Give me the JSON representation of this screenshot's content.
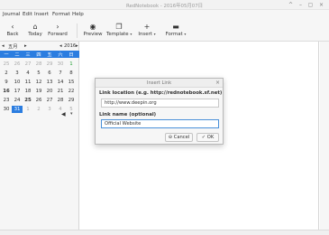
{
  "window": {
    "title": "RedNotebook - 2016年05月07日",
    "controls": [
      "^",
      "–",
      "▢",
      "×"
    ]
  },
  "menu": [
    "Journal",
    "Edit",
    "Insert",
    "Format",
    "Help"
  ],
  "toolbar": {
    "back": "Back",
    "today": "Today",
    "forward": "Forward",
    "preview": "Preview",
    "template": "Template",
    "insert": "Insert",
    "format": "Format"
  },
  "calendar": {
    "month": "五月",
    "year": "2016",
    "weekdays": [
      "一",
      "二",
      "三",
      "四",
      "五",
      "六",
      "日"
    ],
    "rows": [
      [
        "25",
        "26",
        "27",
        "28",
        "29",
        "30",
        "1"
      ],
      [
        "2",
        "3",
        "4",
        "5",
        "6",
        "7",
        "8"
      ],
      [
        "9",
        "10",
        "11",
        "12",
        "13",
        "14",
        "15"
      ],
      [
        "16",
        "17",
        "18",
        "19",
        "20",
        "21",
        "22"
      ],
      [
        "23",
        "24",
        "25",
        "26",
        "27",
        "28",
        "29"
      ],
      [
        "30",
        "31",
        "1",
        "2",
        "3",
        "4",
        "5"
      ]
    ]
  },
  "dialog": {
    "title": "Insert Link",
    "location_label": "Link location (e.g. http://rednotebook.sf.net)",
    "location_value": "http://www.deepin.org",
    "name_label": "Link name (optional)",
    "name_value": "Official Website",
    "cancel": "Cancel",
    "ok": "OK"
  },
  "accent_color": "#2b7de0"
}
